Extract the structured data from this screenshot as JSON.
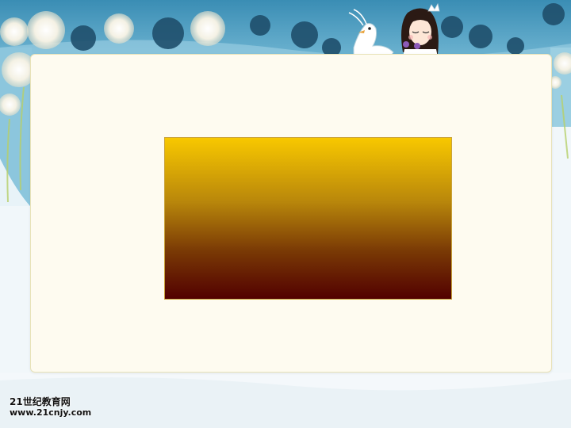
{
  "slide": {
    "background_sky": "#3e93b8",
    "panel_color": "#fefbf0",
    "gradient_top": "#f8c800",
    "gradient_bottom": "#520000"
  },
  "watermark": {
    "title": "21世纪教育网",
    "url": "www.21cnjy.com"
  }
}
